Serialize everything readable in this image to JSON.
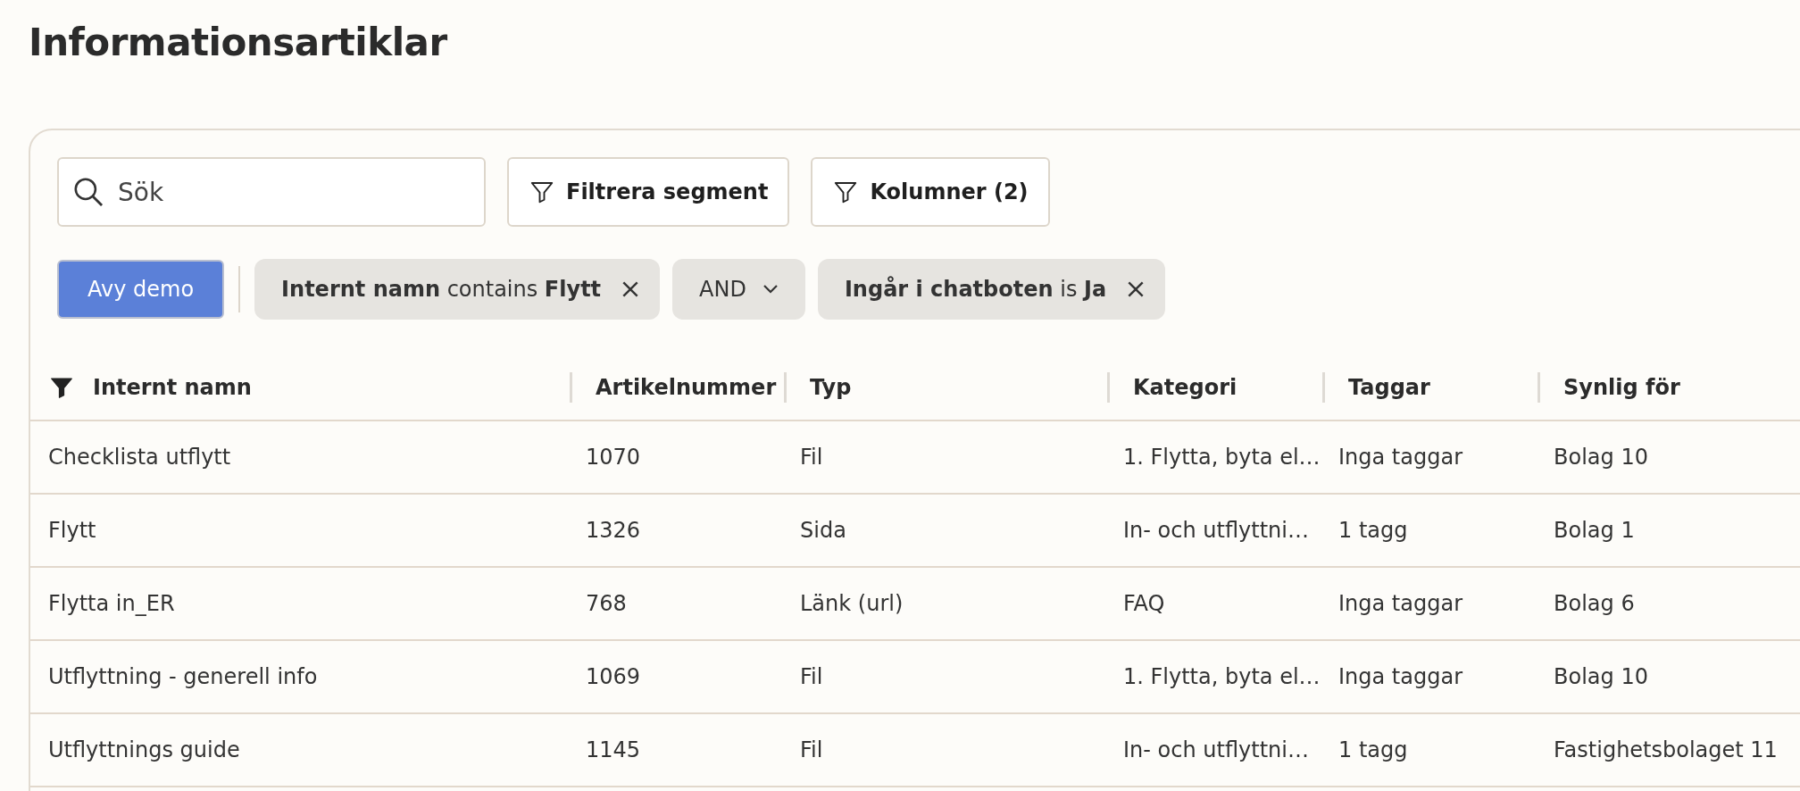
{
  "page_title": "Informationsartiklar",
  "search": {
    "placeholder": "Sök"
  },
  "toolbar_buttons": [
    {
      "label": "Filtrera segment"
    },
    {
      "label": "Kolumner (2)"
    }
  ],
  "view_button": {
    "label": "Avy demo"
  },
  "filters": [
    {
      "kind": "chip",
      "text": "**Internt namn** contains **Flytt**"
    },
    {
      "kind": "operator",
      "text": "AND"
    },
    {
      "kind": "chip",
      "text": "**Ingår i chatboten** is **Ja**"
    }
  ],
  "table": {
    "columns": [
      {
        "label": "Internt namn",
        "filtered": true
      },
      {
        "label": "Artikelnummer",
        "filtered": false
      },
      {
        "label": "Typ",
        "filtered": false
      },
      {
        "label": "Kategori",
        "filtered": false
      },
      {
        "label": "Taggar",
        "filtered": false
      },
      {
        "label": "Synlig för",
        "filtered": false
      }
    ],
    "rows": [
      [
        "Checklista utflytt",
        "1070",
        "Fil",
        "1. Flytta, byta el…",
        "Inga taggar",
        "Bolag 10"
      ],
      [
        "Flytt",
        "1326",
        "Sida",
        "In- och utflyttni…",
        "1 tagg",
        "Bolag 1"
      ],
      [
        "Flytta in_ER",
        "768",
        "Länk (url)",
        "FAQ",
        "Inga taggar",
        "Bolag 6"
      ],
      [
        "Utflyttning - generell info",
        "1069",
        "Fil",
        "1. Flytta, byta el…",
        "Inga taggar",
        "Bolag 10"
      ],
      [
        "Utflyttnings guide",
        "1145",
        "Fil",
        "In- och utflyttni…",
        "1 tagg",
        "Fastighetsbolaget 11"
      ]
    ]
  }
}
